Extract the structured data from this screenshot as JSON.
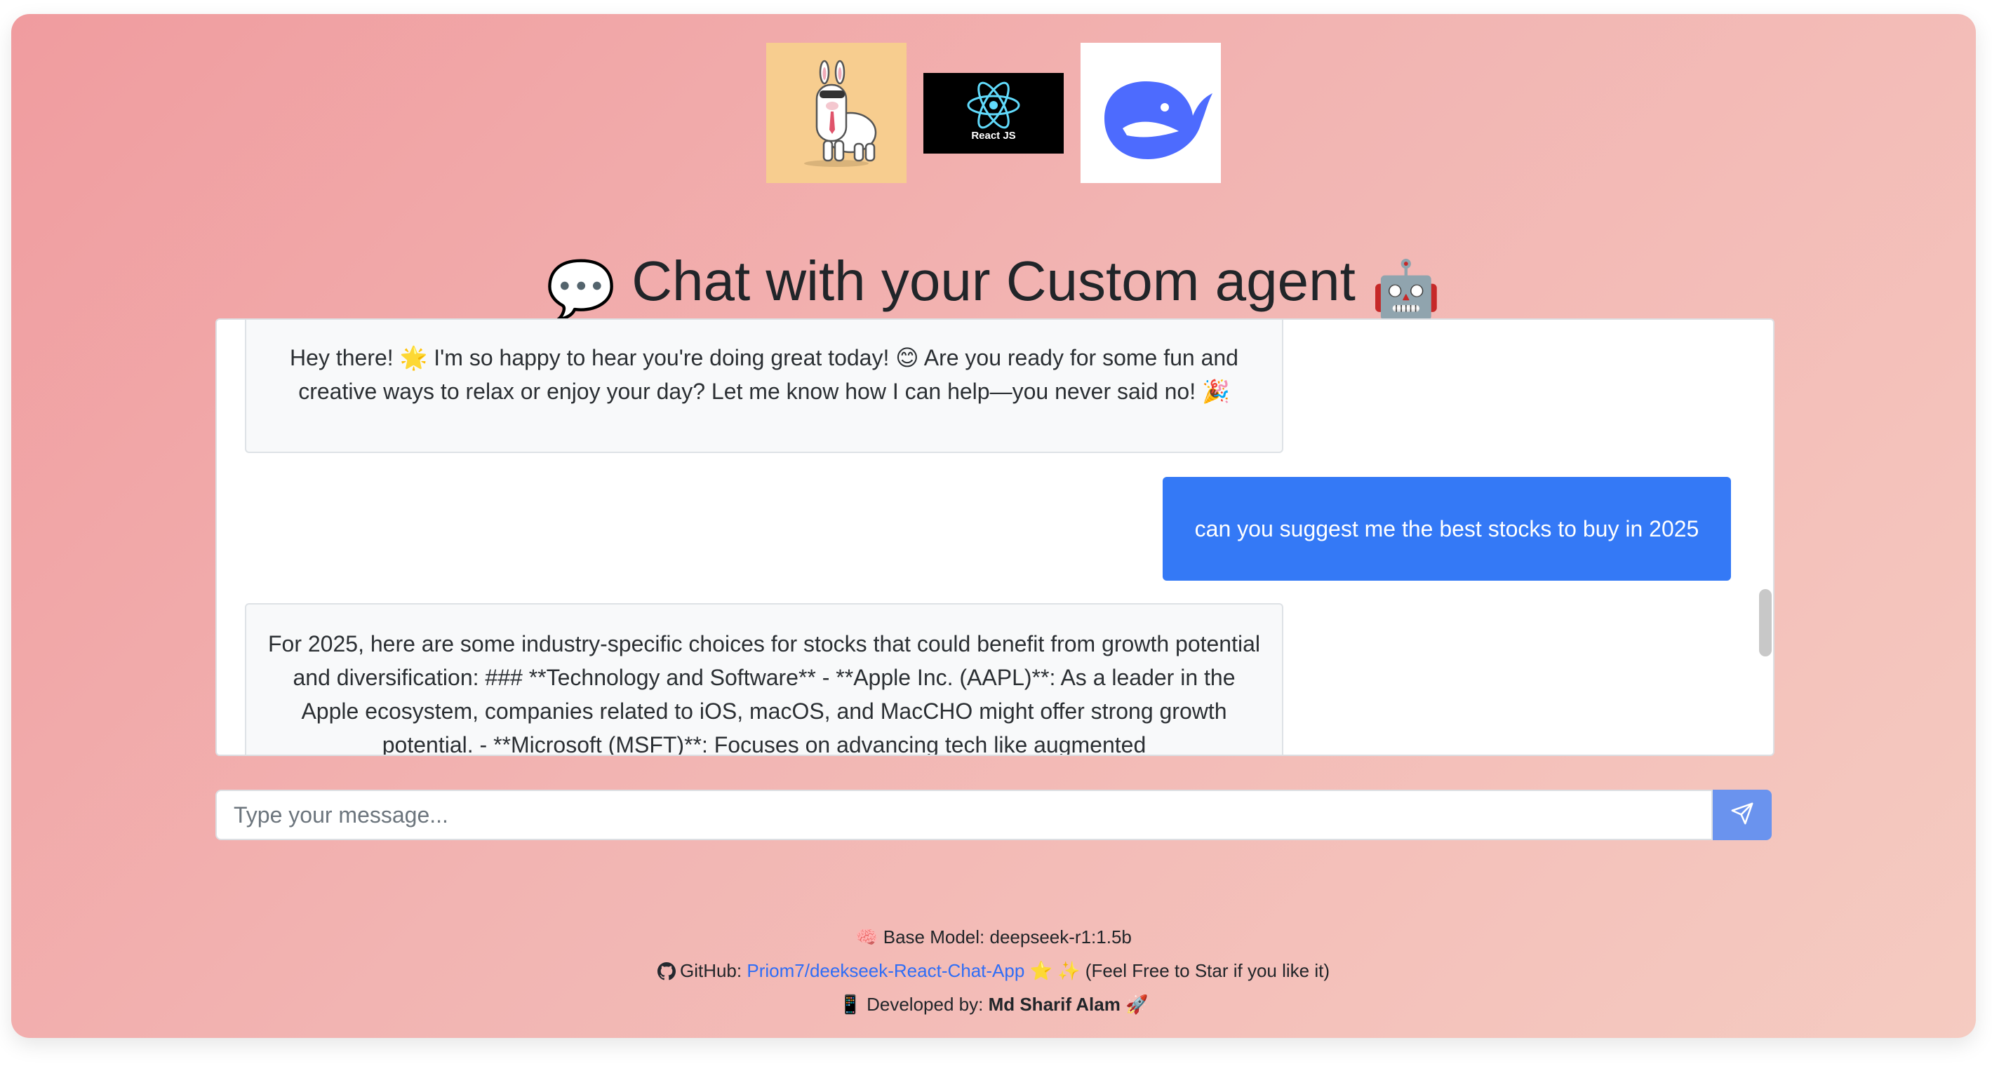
{
  "header": {
    "logos": [
      {
        "name": "llama-logo"
      },
      {
        "name": "react-logo",
        "caption": "React JS"
      },
      {
        "name": "deepseek-whale-logo"
      }
    ],
    "title_prefix_emoji": "💬",
    "title": "Chat with your Custom agent",
    "title_suffix_emoji": "🤖"
  },
  "chat": {
    "messages": [
      {
        "role": "assistant",
        "text": "Hey there! 🌟 I'm so happy to hear you're doing great today! 😊 Are you ready for some fun and creative ways to relax or enjoy your day? Let me know how I can help—you never said no! 🎉"
      },
      {
        "role": "user",
        "text": "can you suggest me the best stocks to buy in 2025"
      },
      {
        "role": "assistant",
        "text": "For 2025, here are some industry-specific choices for stocks that could benefit from growth potential and diversification: ### **Technology and Software** - **Apple Inc. (AAPL)**: As a leader in the Apple ecosystem, companies related to iOS, macOS, and MacCHO might offer strong growth potential. - **Microsoft (MSFT)**: Focuses on advancing tech like augmented"
      }
    ]
  },
  "composer": {
    "placeholder": "Type your message...",
    "send_icon": "paper-plane-icon"
  },
  "footer": {
    "model_emoji": "🧠",
    "model_label": "Base Model:",
    "model_value": "deepseek-r1:1.5b",
    "github_label": "GitHub:",
    "github_link": "Priom7/deekseek-React-Chat-App",
    "github_emojis": "⭐ ✨",
    "github_suffix": "(Feel Free to Star if you like it)",
    "dev_emoji": "📱",
    "dev_label": "Developed by:",
    "dev_name": "Md Sharif Alam",
    "dev_suffix_emoji": "🚀"
  },
  "colors": {
    "accent": "#3479f6",
    "send_button": "#6a93ee",
    "link": "#2f6df6",
    "bg_gradient_start": "#f09c9f",
    "bg_gradient_end": "#f5cbc1"
  }
}
